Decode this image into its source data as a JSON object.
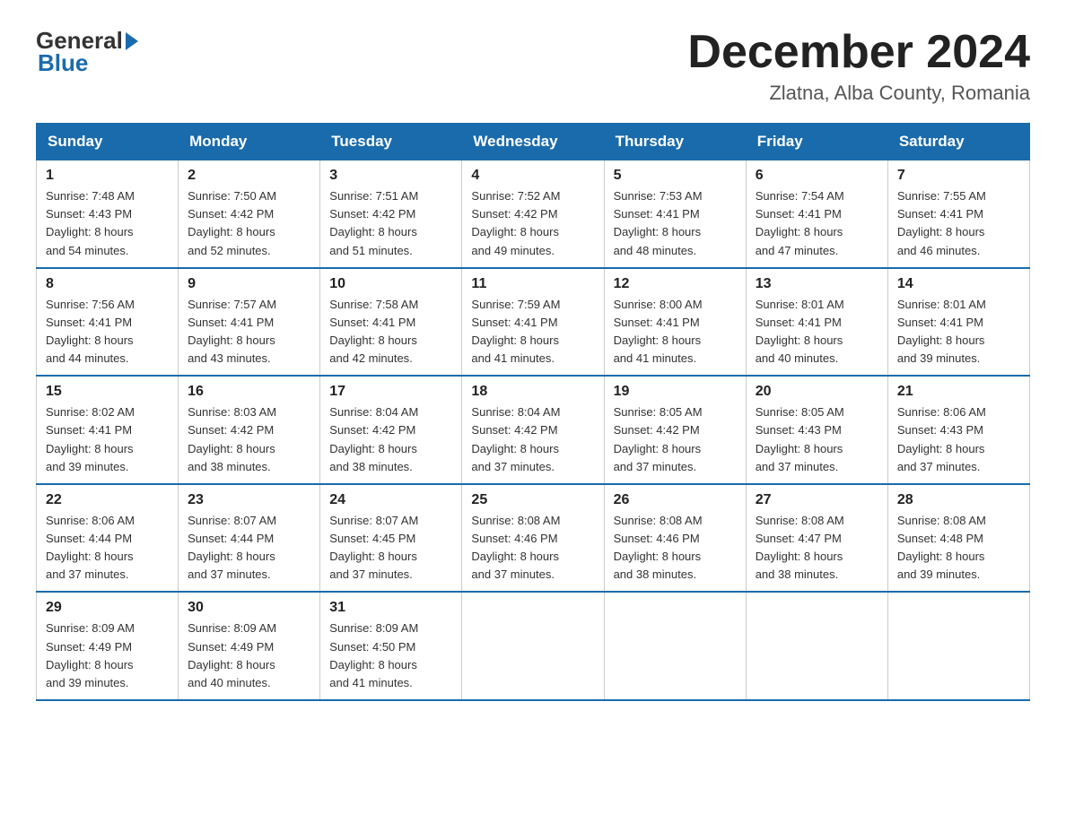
{
  "logo": {
    "general": "General",
    "blue": "Blue"
  },
  "title": "December 2024",
  "subtitle": "Zlatna, Alba County, Romania",
  "days_of_week": [
    "Sunday",
    "Monday",
    "Tuesday",
    "Wednesday",
    "Thursday",
    "Friday",
    "Saturday"
  ],
  "weeks": [
    [
      {
        "day": "1",
        "sunrise": "7:48 AM",
        "sunset": "4:43 PM",
        "daylight": "8 hours and 54 minutes."
      },
      {
        "day": "2",
        "sunrise": "7:50 AM",
        "sunset": "4:42 PM",
        "daylight": "8 hours and 52 minutes."
      },
      {
        "day": "3",
        "sunrise": "7:51 AM",
        "sunset": "4:42 PM",
        "daylight": "8 hours and 51 minutes."
      },
      {
        "day": "4",
        "sunrise": "7:52 AM",
        "sunset": "4:42 PM",
        "daylight": "8 hours and 49 minutes."
      },
      {
        "day": "5",
        "sunrise": "7:53 AM",
        "sunset": "4:41 PM",
        "daylight": "8 hours and 48 minutes."
      },
      {
        "day": "6",
        "sunrise": "7:54 AM",
        "sunset": "4:41 PM",
        "daylight": "8 hours and 47 minutes."
      },
      {
        "day": "7",
        "sunrise": "7:55 AM",
        "sunset": "4:41 PM",
        "daylight": "8 hours and 46 minutes."
      }
    ],
    [
      {
        "day": "8",
        "sunrise": "7:56 AM",
        "sunset": "4:41 PM",
        "daylight": "8 hours and 44 minutes."
      },
      {
        "day": "9",
        "sunrise": "7:57 AM",
        "sunset": "4:41 PM",
        "daylight": "8 hours and 43 minutes."
      },
      {
        "day": "10",
        "sunrise": "7:58 AM",
        "sunset": "4:41 PM",
        "daylight": "8 hours and 42 minutes."
      },
      {
        "day": "11",
        "sunrise": "7:59 AM",
        "sunset": "4:41 PM",
        "daylight": "8 hours and 41 minutes."
      },
      {
        "day": "12",
        "sunrise": "8:00 AM",
        "sunset": "4:41 PM",
        "daylight": "8 hours and 41 minutes."
      },
      {
        "day": "13",
        "sunrise": "8:01 AM",
        "sunset": "4:41 PM",
        "daylight": "8 hours and 40 minutes."
      },
      {
        "day": "14",
        "sunrise": "8:01 AM",
        "sunset": "4:41 PM",
        "daylight": "8 hours and 39 minutes."
      }
    ],
    [
      {
        "day": "15",
        "sunrise": "8:02 AM",
        "sunset": "4:41 PM",
        "daylight": "8 hours and 39 minutes."
      },
      {
        "day": "16",
        "sunrise": "8:03 AM",
        "sunset": "4:42 PM",
        "daylight": "8 hours and 38 minutes."
      },
      {
        "day": "17",
        "sunrise": "8:04 AM",
        "sunset": "4:42 PM",
        "daylight": "8 hours and 38 minutes."
      },
      {
        "day": "18",
        "sunrise": "8:04 AM",
        "sunset": "4:42 PM",
        "daylight": "8 hours and 37 minutes."
      },
      {
        "day": "19",
        "sunrise": "8:05 AM",
        "sunset": "4:42 PM",
        "daylight": "8 hours and 37 minutes."
      },
      {
        "day": "20",
        "sunrise": "8:05 AM",
        "sunset": "4:43 PM",
        "daylight": "8 hours and 37 minutes."
      },
      {
        "day": "21",
        "sunrise": "8:06 AM",
        "sunset": "4:43 PM",
        "daylight": "8 hours and 37 minutes."
      }
    ],
    [
      {
        "day": "22",
        "sunrise": "8:06 AM",
        "sunset": "4:44 PM",
        "daylight": "8 hours and 37 minutes."
      },
      {
        "day": "23",
        "sunrise": "8:07 AM",
        "sunset": "4:44 PM",
        "daylight": "8 hours and 37 minutes."
      },
      {
        "day": "24",
        "sunrise": "8:07 AM",
        "sunset": "4:45 PM",
        "daylight": "8 hours and 37 minutes."
      },
      {
        "day": "25",
        "sunrise": "8:08 AM",
        "sunset": "4:46 PM",
        "daylight": "8 hours and 37 minutes."
      },
      {
        "day": "26",
        "sunrise": "8:08 AM",
        "sunset": "4:46 PM",
        "daylight": "8 hours and 38 minutes."
      },
      {
        "day": "27",
        "sunrise": "8:08 AM",
        "sunset": "4:47 PM",
        "daylight": "8 hours and 38 minutes."
      },
      {
        "day": "28",
        "sunrise": "8:08 AM",
        "sunset": "4:48 PM",
        "daylight": "8 hours and 39 minutes."
      }
    ],
    [
      {
        "day": "29",
        "sunrise": "8:09 AM",
        "sunset": "4:49 PM",
        "daylight": "8 hours and 39 minutes."
      },
      {
        "day": "30",
        "sunrise": "8:09 AM",
        "sunset": "4:49 PM",
        "daylight": "8 hours and 40 minutes."
      },
      {
        "day": "31",
        "sunrise": "8:09 AM",
        "sunset": "4:50 PM",
        "daylight": "8 hours and 41 minutes."
      },
      null,
      null,
      null,
      null
    ]
  ],
  "labels": {
    "sunrise": "Sunrise:",
    "sunset": "Sunset:",
    "daylight": "Daylight:"
  }
}
